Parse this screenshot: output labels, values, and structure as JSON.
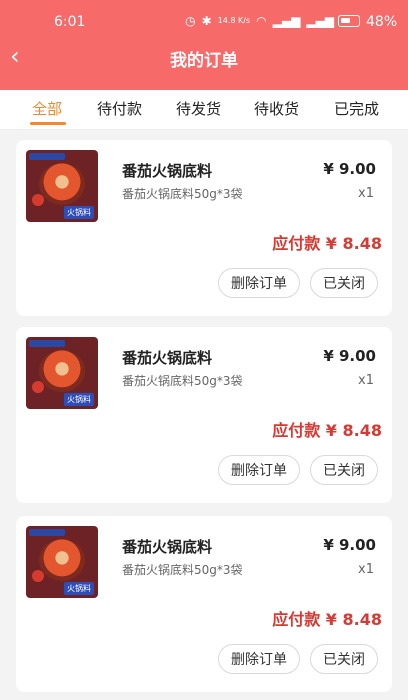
{
  "status_bar": {
    "time": "6:01",
    "network_speed": "14.8 K/s",
    "signal_labels": [
      "4G",
      "4G"
    ],
    "battery": "48%"
  },
  "header": {
    "title": "我的订单"
  },
  "tabs": [
    {
      "label": "全部",
      "active": true
    },
    {
      "label": "待付款",
      "active": false
    },
    {
      "label": "待发货",
      "active": false
    },
    {
      "label": "待收货",
      "active": false
    },
    {
      "label": "已完成",
      "active": false
    }
  ],
  "orders": [
    {
      "product_name": "番茄火锅底料",
      "spec": "番茄火锅底料50g*3袋",
      "price": "¥ 9.00",
      "quantity": "x1",
      "amount_due": "应付款 ¥ 8.48",
      "buttons": {
        "delete": "删除订单",
        "closed": "已关闭"
      }
    },
    {
      "product_name": "番茄火锅底料",
      "spec": "番茄火锅底料50g*3袋",
      "price": "¥ 9.00",
      "quantity": "x1",
      "amount_due": "应付款 ¥ 8.48",
      "buttons": {
        "delete": "删除订单",
        "closed": "已关闭"
      }
    },
    {
      "product_name": "番茄火锅底料",
      "spec": "番茄火锅底料50g*3袋",
      "price": "¥ 9.00",
      "quantity": "x1",
      "amount_due": "应付款 ¥ 8.48",
      "buttons": {
        "delete": "删除订单",
        "closed": "已关闭"
      }
    }
  ],
  "colors": {
    "header": "#f66a6a",
    "accent": "#f08a2a",
    "price_due": "#d63a34"
  }
}
